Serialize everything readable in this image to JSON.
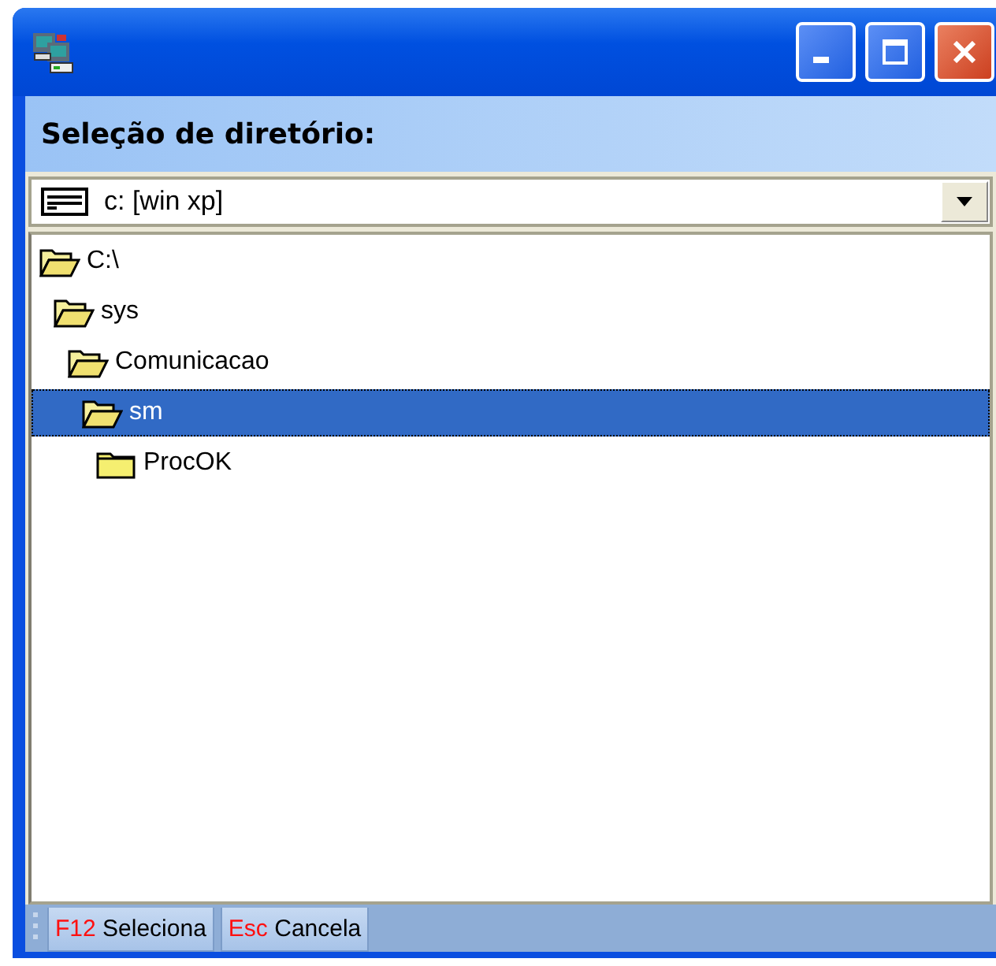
{
  "header": {
    "title": "Seleção de diretório:"
  },
  "drive_select": {
    "value": "c: [win xp]"
  },
  "tree": [
    {
      "label": "C:\\",
      "expanded": true,
      "selected": false,
      "children": [
        {
          "label": "sys",
          "expanded": true,
          "selected": false,
          "children": [
            {
              "label": "Comunicacao",
              "expanded": true,
              "selected": false,
              "children": [
                {
                  "label": "sm",
                  "expanded": true,
                  "selected": true,
                  "children": [
                    {
                      "label": "ProcOK",
                      "expanded": false,
                      "selected": false
                    }
                  ]
                }
              ]
            }
          ]
        }
      ]
    }
  ],
  "toolbar": [
    {
      "key": "F12",
      "label": "Seleciona"
    },
    {
      "key": "Esc",
      "label": "Cancela"
    }
  ]
}
